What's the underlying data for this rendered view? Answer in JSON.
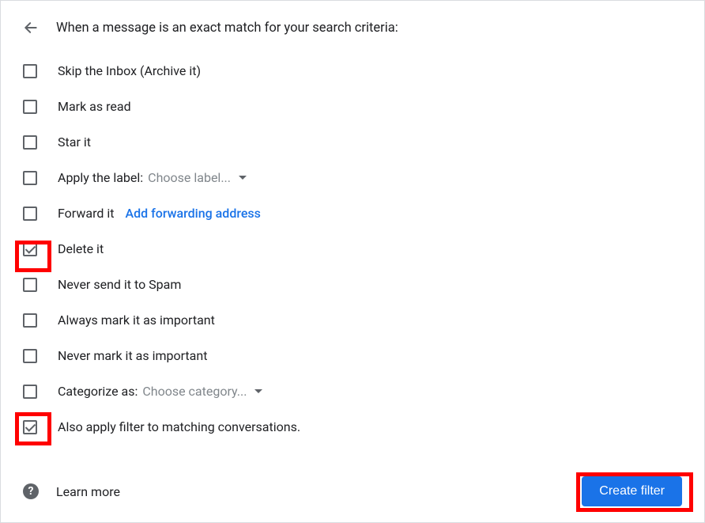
{
  "header": {
    "title": "When a message is an exact match for your search criteria:"
  },
  "options": {
    "skip_inbox": {
      "label": "Skip the Inbox (Archive it)",
      "checked": false
    },
    "mark_read": {
      "label": "Mark as read",
      "checked": false
    },
    "star_it": {
      "label": "Star it",
      "checked": false
    },
    "apply_label": {
      "label": "Apply the label:",
      "select_text": "Choose label...",
      "checked": false
    },
    "forward_it": {
      "label": "Forward it",
      "link_text": "Add forwarding address",
      "checked": false
    },
    "delete_it": {
      "label": "Delete it",
      "checked": true
    },
    "never_spam": {
      "label": "Never send it to Spam",
      "checked": false
    },
    "always_important": {
      "label": "Always mark it as important",
      "checked": false
    },
    "never_important": {
      "label": "Never mark it as important",
      "checked": false
    },
    "categorize_as": {
      "label": "Categorize as:",
      "select_text": "Choose category...",
      "checked": false
    },
    "also_apply": {
      "label": "Also apply filter to matching conversations.",
      "checked": true
    }
  },
  "footer": {
    "learn_more": "Learn more",
    "create_filter": "Create filter"
  }
}
